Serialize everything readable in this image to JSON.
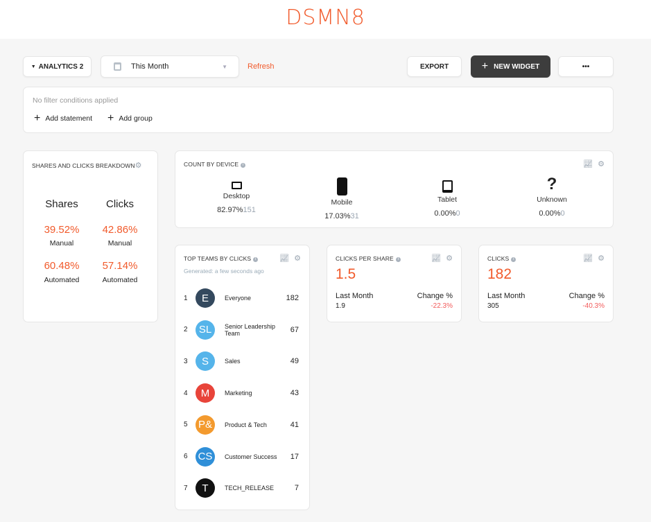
{
  "header": {
    "logo": "DSMN8"
  },
  "toolbar": {
    "dashboard": "ANALYTICS 2",
    "date_range": "This Month",
    "refresh": "Refresh",
    "export": "EXPORT",
    "new_widget": "NEW WIDGET",
    "more": "•••"
  },
  "filter": {
    "empty": "No filter conditions applied",
    "add_statement": "Add statement",
    "add_group": "Add group"
  },
  "breakdown": {
    "title": "SHARES AND CLICKS BREAKDOWN",
    "col1": "Shares",
    "col2": "Clicks",
    "shares_manual": "39.52%",
    "clicks_manual": "42.86%",
    "manual": "Manual",
    "shares_auto": "60.48%",
    "clicks_auto": "57.14%",
    "automated": "Automated"
  },
  "devices": {
    "title": "COUNT BY DEVICE",
    "items": [
      {
        "label": "Desktop",
        "pct": "82.97%",
        "count": "151"
      },
      {
        "label": "Mobile",
        "pct": "17.03%",
        "count": "31"
      },
      {
        "label": "Tablet",
        "pct": "0.00%",
        "count": "0"
      },
      {
        "label": "Unknown",
        "pct": "0.00%",
        "count": "0"
      }
    ]
  },
  "teams": {
    "title": "TOP TEAMS BY CLICKS",
    "generated": "Generated: a few seconds ago",
    "items": [
      {
        "rank": "1",
        "initials": "E",
        "name": "Everyone",
        "count": "182",
        "color": "#34495e"
      },
      {
        "rank": "2",
        "initials": "SL",
        "name": "Senior Leadership Team",
        "count": "67",
        "color": "#55b4ea"
      },
      {
        "rank": "3",
        "initials": "S",
        "name": "Sales",
        "count": "49",
        "color": "#55b4ea"
      },
      {
        "rank": "4",
        "initials": "M",
        "name": "Marketing",
        "count": "43",
        "color": "#e8443a"
      },
      {
        "rank": "5",
        "initials": "P&",
        "name": "Product & Tech",
        "count": "41",
        "color": "#f39a2e"
      },
      {
        "rank": "6",
        "initials": "CS",
        "name": "Customer Success",
        "count": "17",
        "color": "#2f8fd8"
      },
      {
        "rank": "7",
        "initials": "T",
        "name": "TECH_RELEASE",
        "count": "7",
        "color": "#111111"
      }
    ]
  },
  "cps": {
    "title": "CLICKS PER SHARE",
    "value": "1.5",
    "last_label": "Last Month",
    "last": "1.9",
    "change_label": "Change %",
    "change": "-22.3%"
  },
  "clicks": {
    "title": "CLICKS",
    "value": "182",
    "last_label": "Last Month",
    "last": "305",
    "change_label": "Change %",
    "change": "-40.3%"
  }
}
